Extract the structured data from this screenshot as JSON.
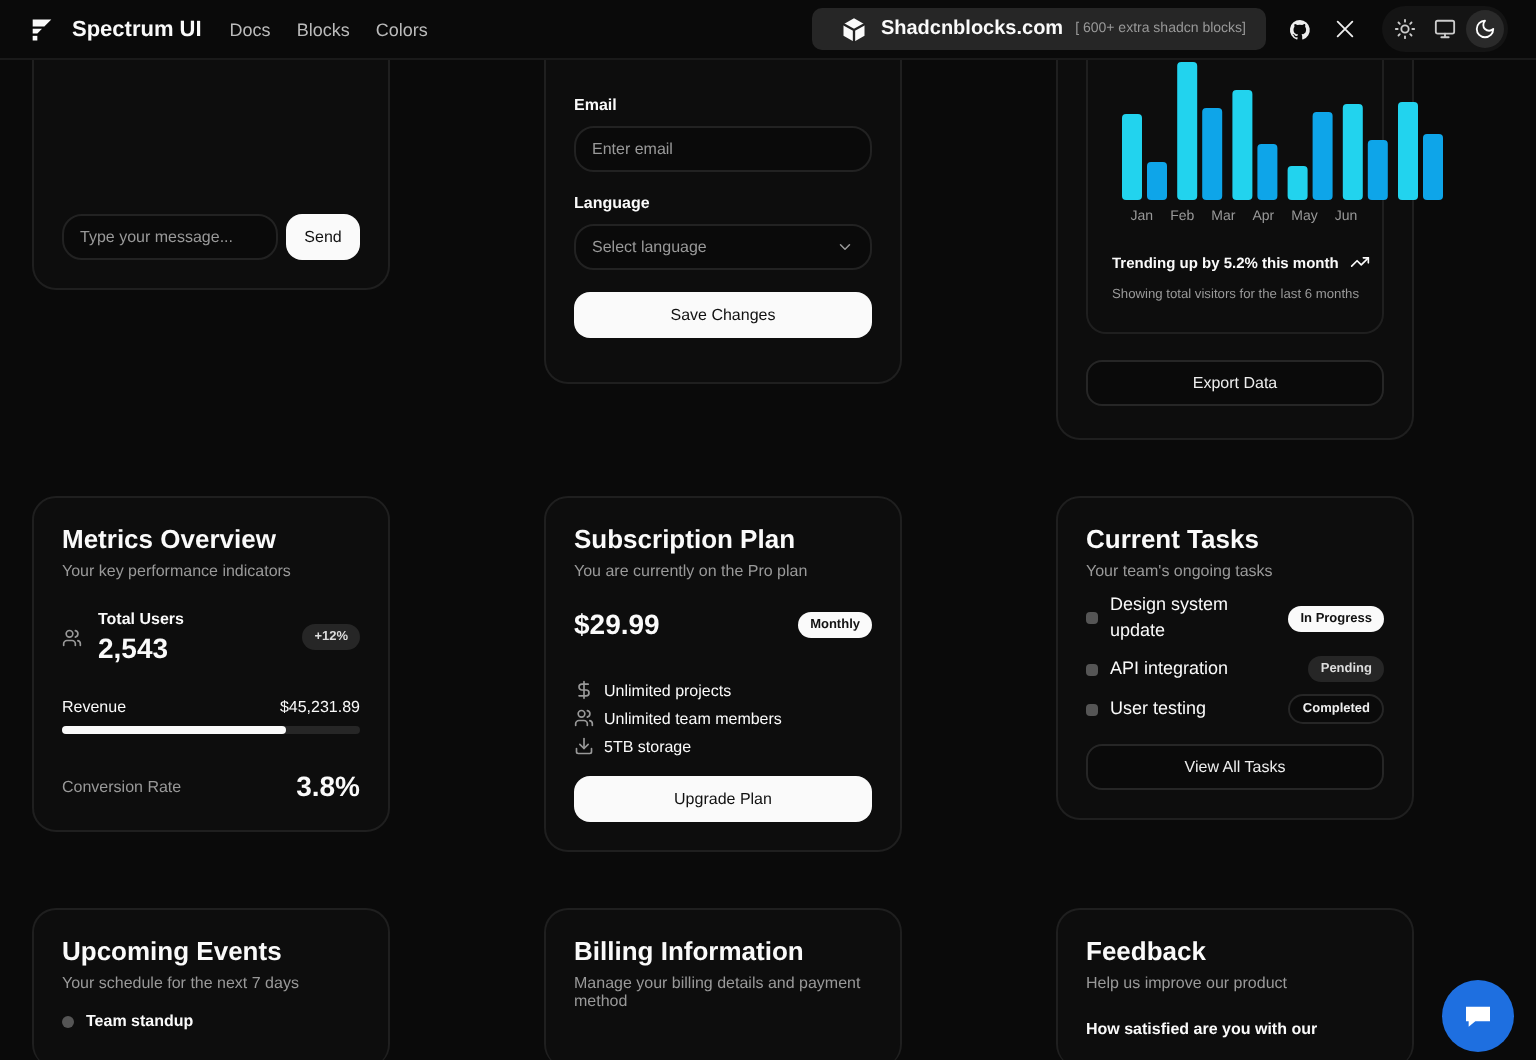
{
  "header": {
    "brand": "Spectrum UI",
    "nav": [
      {
        "label": "Docs"
      },
      {
        "label": "Blocks"
      },
      {
        "label": "Colors"
      }
    ],
    "promo": {
      "title": "Shadcnblocks.com",
      "note": "[ 600+ extra shadcn blocks]"
    },
    "theme": [
      {
        "kind": "light",
        "selected": false
      },
      {
        "kind": "system",
        "selected": false
      },
      {
        "kind": "dark",
        "selected": true
      }
    ]
  },
  "chat": {
    "placeholder": "Type your message...",
    "button": "Send"
  },
  "profile_form": {
    "fields": [
      {
        "kind": "input",
        "label": "Email",
        "placeholder": "Enter email"
      },
      {
        "kind": "select",
        "label": "Language",
        "placeholder": "Select language"
      }
    ],
    "button": "Save Changes"
  },
  "visitors": {
    "months": [
      "Jan",
      "Feb",
      "Mar",
      "Apr",
      "May",
      "Jun"
    ],
    "trend": "Trending up by 5.2% this month",
    "caption": "Showing total visitors for the last 6 months",
    "button": "Export Data"
  },
  "metrics": {
    "title": "Metrics Overview",
    "subtitle": "Your key performance indicators",
    "users_label": "Total Users",
    "users_value": "2,543",
    "change": "+12%",
    "revenue_label": "Revenue",
    "revenue_value": "$45,231.89",
    "level": 0.75,
    "conversion_label": "Conversion Rate",
    "conversion_value": "3.8%"
  },
  "subscription": {
    "title": "Subscription Plan",
    "subtitle": "You are currently on the Pro plan",
    "price": "$29.99",
    "period": "Monthly",
    "features": [
      {
        "kind": "dollar",
        "text": "Unlimited projects"
      },
      {
        "kind": "users",
        "text": "Unlimited team members"
      },
      {
        "kind": "download",
        "text": "5TB storage"
      }
    ],
    "button": "Upgrade Plan"
  },
  "tasks": {
    "title": "Current Tasks",
    "subtitle": "Your team's ongoing tasks",
    "items": [
      {
        "text": "Design system update",
        "checked": false,
        "status": "In Progress",
        "kind": "progress"
      },
      {
        "text": "API integration",
        "checked": false,
        "status": "Pending",
        "kind": "pending"
      },
      {
        "text": "User testing",
        "checked": false,
        "status": "Completed",
        "kind": "completed"
      }
    ],
    "button": "View All Tasks"
  },
  "events": {
    "title": "Upcoming Events",
    "subtitle": "Your schedule for the next 7 days",
    "first_event": "Team standup"
  },
  "billing": {
    "title": "Billing Information",
    "subtitle": "Manage your billing details and payment method"
  },
  "feedback": {
    "title": "Feedback",
    "subtitle": "Help us improve our product",
    "question": "How satisfied are you with our"
  }
}
